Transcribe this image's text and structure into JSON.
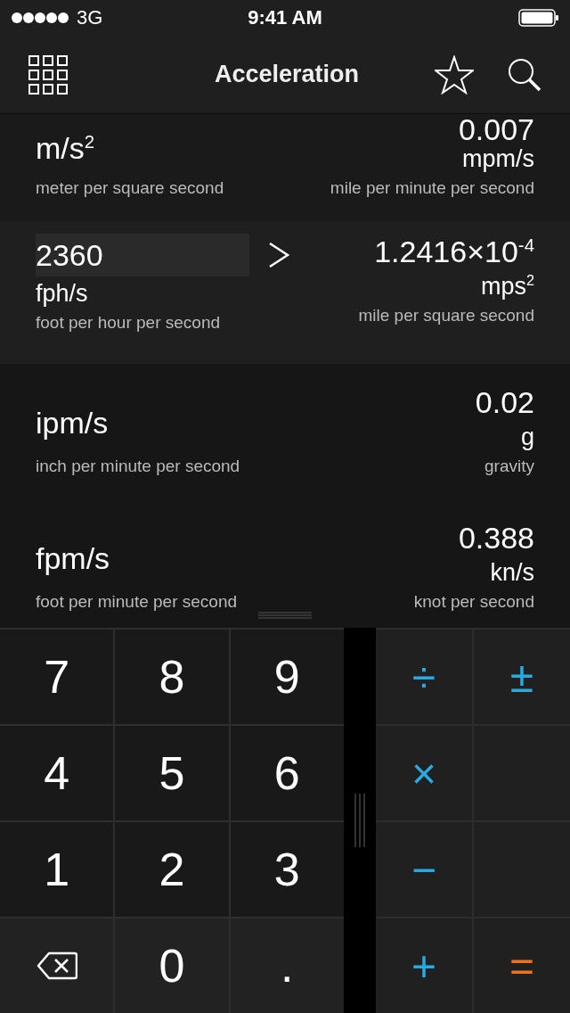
{
  "status_bar": {
    "carrier": "3G",
    "time": "9:41 AM"
  },
  "nav": {
    "title": "Acceleration"
  },
  "rows": [
    {
      "unit": "m/s$^{2}$",
      "unit_name": "meter per square second",
      "value": "0.007",
      "value_unit": "mpm/s",
      "value_unit_name": "mile per minute per second",
      "selected": false
    },
    {
      "unit": "fph/s",
      "unit_name": "foot per hour per second",
      "input": "2360",
      "value": "1.2416×10$^{-4}$",
      "value_unit": "mps$^{2}$",
      "value_unit_name": "mile per square second",
      "selected": true
    },
    {
      "unit": "ipm/s",
      "unit_name": "inch per minute per second",
      "value": "0.02",
      "value_unit": "g",
      "value_unit_name": "gravity",
      "selected": false
    },
    {
      "unit": "fpm/s",
      "unit_name": "foot per minute per second",
      "value": "0.388",
      "value_unit": "kn/s",
      "value_unit_name": "knot per second",
      "selected": false
    }
  ],
  "digit_keys": [
    {
      "kind": "digit",
      "label": "7"
    },
    {
      "kind": "digit",
      "label": "8"
    },
    {
      "kind": "digit",
      "label": "9"
    },
    {
      "kind": "digit",
      "label": "4"
    },
    {
      "kind": "digit",
      "label": "5"
    },
    {
      "kind": "digit",
      "label": "6"
    },
    {
      "kind": "digit",
      "label": "1"
    },
    {
      "kind": "digit",
      "label": "2"
    },
    {
      "kind": "digit",
      "label": "3"
    },
    {
      "kind": "backspace"
    },
    {
      "kind": "digit",
      "label": "0"
    },
    {
      "kind": "digit",
      "label": "."
    }
  ],
  "operator_keys": [
    {
      "kind": "op",
      "label": "÷",
      "color": "#29abe2"
    },
    {
      "kind": "op",
      "label": "±",
      "color": "#29abe2"
    },
    {
      "kind": "op",
      "label": "×",
      "color": "#29abe2"
    },
    {
      "kind": "blank"
    },
    {
      "kind": "op",
      "label": "−",
      "color": "#29abe2"
    },
    {
      "kind": "blank"
    },
    {
      "kind": "op",
      "label": "+",
      "color": "#29abe2"
    },
    {
      "kind": "op",
      "label": "=",
      "color": "#e8731f"
    }
  ]
}
